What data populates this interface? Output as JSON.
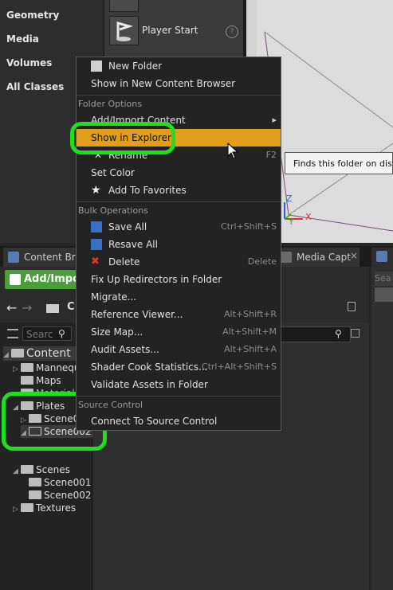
{
  "place_actors": {
    "categories": [
      "Geometry",
      "Media",
      "Volumes",
      "All Classes"
    ],
    "player_start": "Player Start"
  },
  "viewport": {
    "tooltip": "Finds this folder on disk.",
    "axis_z": "Z",
    "axis_y": "Y",
    "axis_x": "X"
  },
  "tabs": {
    "content_browser": "Content Bro",
    "media_capture": "Media Capt"
  },
  "content_browser": {
    "add_import": "Add/Impo",
    "nav_path": "C",
    "search_placeholder": "Searc",
    "right_search_placeholder": "Sea",
    "tree": {
      "root": "Content",
      "items": [
        "Mannequ",
        "Maps",
        "Materials",
        "Plates",
        "Scene0",
        "Scene002",
        "Scenes",
        "Scene001",
        "Scene002",
        "Textures"
      ]
    }
  },
  "context_menu": {
    "top_items": [
      {
        "label": "New Folder",
        "icon": "new-folder-icon"
      },
      {
        "label": "Show in New Content Browser"
      }
    ],
    "folder_options_header": "Folder Options",
    "folder_items": [
      {
        "label": "Add/Import Content",
        "submenu": true
      },
      {
        "label": "Show in Explorer",
        "highlighted": true
      },
      {
        "label": "Rename",
        "shortcut": "F2",
        "icon": "rename-icon"
      },
      {
        "label": "Set Color"
      },
      {
        "label": "Add To Favorites",
        "icon": "star-icon"
      }
    ],
    "bulk_header": "Bulk Operations",
    "bulk_items": [
      {
        "label": "Save All",
        "shortcut": "Ctrl+Shift+S",
        "icon": "save-icon"
      },
      {
        "label": "Resave All",
        "icon": "save-icon"
      },
      {
        "label": "Delete",
        "shortcut": "Delete",
        "icon": "delete-icon"
      },
      {
        "label": "Fix Up Redirectors in Folder"
      },
      {
        "label": "Migrate..."
      },
      {
        "label": "Reference Viewer...",
        "shortcut": "Alt+Shift+R"
      },
      {
        "label": "Size Map...",
        "shortcut": "Alt+Shift+M"
      },
      {
        "label": "Audit Assets...",
        "shortcut": "Alt+Shift+A"
      },
      {
        "label": "Shader Cook Statistics...",
        "shortcut": "Ctrl+Alt+Shift+S"
      },
      {
        "label": "Validate Assets in Folder"
      }
    ],
    "source_header": "Source Control",
    "source_items": [
      {
        "label": "Connect To Source Control"
      }
    ]
  },
  "colors": {
    "highlight": "#e09e1a",
    "annotation_ring": "#1ee01e",
    "add_import": "#4a9e3a"
  }
}
